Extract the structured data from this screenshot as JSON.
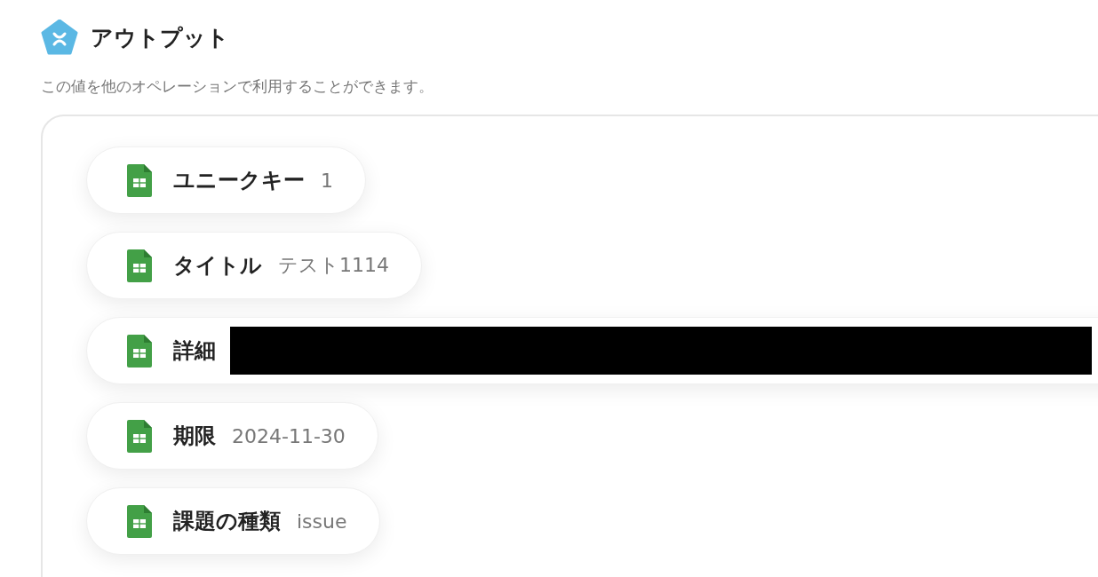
{
  "section": {
    "title": "アウトプット",
    "description": "この値を他のオペレーションで利用することができます。"
  },
  "outputs": [
    {
      "kind": "text",
      "label": "ユニークキー",
      "value": "1"
    },
    {
      "kind": "text",
      "label": "タイトル",
      "value": "テスト1114"
    },
    {
      "kind": "redacted",
      "label": "詳細"
    },
    {
      "kind": "text",
      "label": "期限",
      "value": "2024-11-30"
    },
    {
      "kind": "text",
      "label": "課題の種類",
      "value": "issue"
    }
  ]
}
